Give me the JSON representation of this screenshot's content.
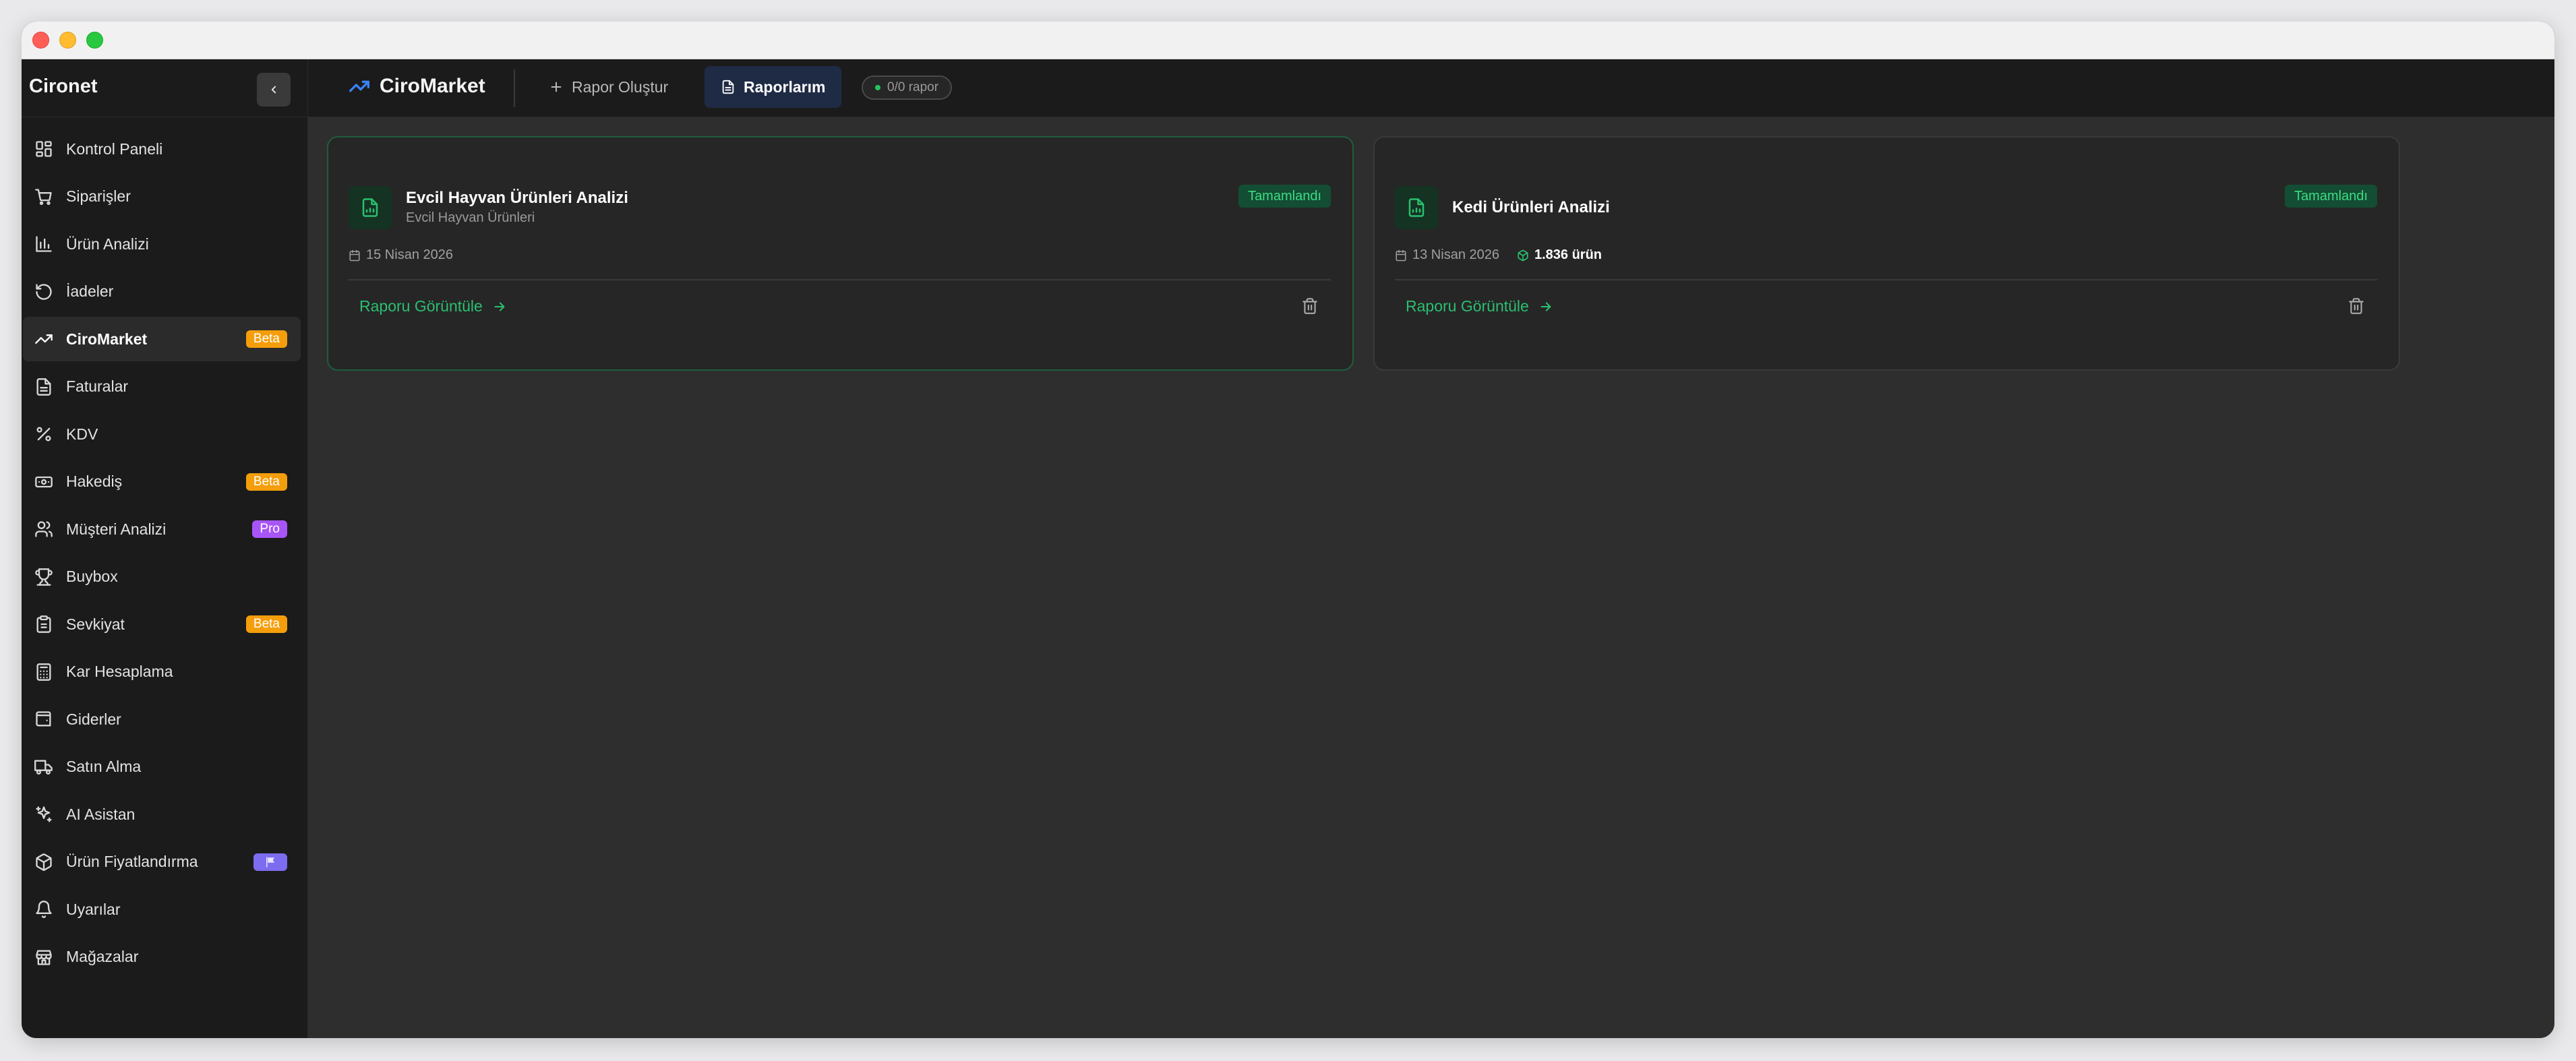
{
  "sidebar": {
    "brand": "Cironet",
    "items": [
      {
        "label": "Kontrol Paneli",
        "icon": "layout-grid-icon"
      },
      {
        "label": "Siparişler",
        "icon": "shopping-cart-icon"
      },
      {
        "label": "Ürün Analizi",
        "icon": "bar-chart-icon"
      },
      {
        "label": "İadeler",
        "icon": "undo-icon"
      },
      {
        "label": "CiroMarket",
        "icon": "trending-up-icon",
        "badge": "Beta",
        "active": true
      },
      {
        "label": "Faturalar",
        "icon": "document-icon"
      },
      {
        "label": "KDV",
        "icon": "percent-icon"
      },
      {
        "label": "Hakediş",
        "icon": "banknote-icon",
        "badge": "Beta"
      },
      {
        "label": "Müşteri Analizi",
        "icon": "users-icon",
        "badge": "Pro"
      },
      {
        "label": "Buybox",
        "icon": "trophy-icon"
      },
      {
        "label": "Sevkiyat",
        "icon": "clipboard-icon",
        "badge": "Beta"
      },
      {
        "label": "Kar Hesaplama",
        "icon": "calculator-icon"
      },
      {
        "label": "Giderler",
        "icon": "wallet-icon"
      },
      {
        "label": "Satın Alma",
        "icon": "truck-icon"
      },
      {
        "label": "AI Asistan",
        "icon": "sparkles-icon"
      },
      {
        "label": "Ürün Fiyatlandırma",
        "icon": "box-icon",
        "badge_icon": "flag-icon"
      },
      {
        "label": "Uyarılar",
        "icon": "bell-icon"
      },
      {
        "label": "Mağazalar",
        "icon": "store-icon"
      }
    ]
  },
  "topbar": {
    "brand": "CiroMarket",
    "create_tab": "Rapor Oluştur",
    "reports_tab": "Raporlarım",
    "report_count": "0/0 rapor"
  },
  "reports": [
    {
      "title": "Evcil Hayvan Ürünleri Analizi",
      "subtitle": "Evcil Hayvan Ürünleri",
      "status": "Tamamlandı",
      "date": "15 Nisan 2026",
      "view_label": "Raporu Görüntüle"
    },
    {
      "title": "Kedi Ürünleri Analizi",
      "status": "Tamamlandı",
      "date": "13 Nisan 2026",
      "product_count": "1.836 ürün",
      "view_label": "Raporu Görüntüle"
    }
  ],
  "colors": {
    "accent_green": "#2bbf70",
    "badge_beta": "#f59e0b",
    "badge_pro": "#a855f7",
    "brand_blue": "#3b82f6"
  }
}
